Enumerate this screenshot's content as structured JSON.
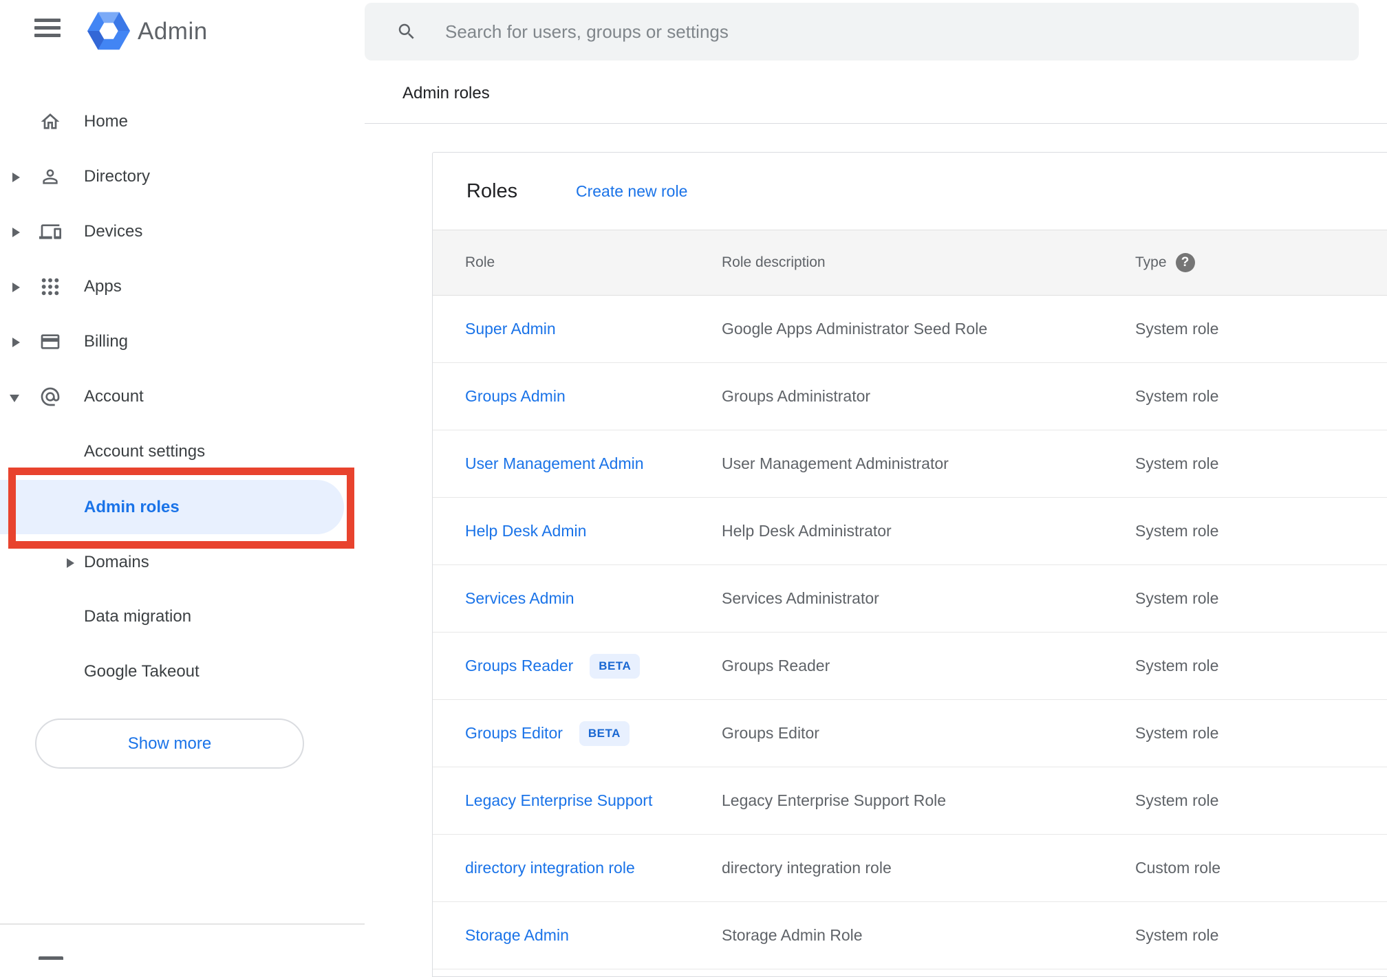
{
  "app": {
    "title": "Admin"
  },
  "search": {
    "placeholder": "Search for users, groups or settings"
  },
  "breadcrumb": "Admin roles",
  "sidebar": {
    "items": [
      {
        "label": "Home",
        "icon": "home-icon",
        "expandable": false
      },
      {
        "label": "Directory",
        "icon": "person-icon",
        "expandable": true
      },
      {
        "label": "Devices",
        "icon": "devices-icon",
        "expandable": true
      },
      {
        "label": "Apps",
        "icon": "apps-grid-icon",
        "expandable": true
      },
      {
        "label": "Billing",
        "icon": "credit-card-icon",
        "expandable": true
      },
      {
        "label": "Account",
        "icon": "at-sign-icon",
        "expandable": true,
        "expanded": true
      }
    ],
    "account_children": [
      {
        "label": "Account settings",
        "selected": false
      },
      {
        "label": "Admin roles",
        "selected": true
      },
      {
        "label": "Domains",
        "expandable": true
      },
      {
        "label": "Data migration"
      },
      {
        "label": "Google Takeout"
      }
    ],
    "show_more_label": "Show more"
  },
  "annotation": {
    "type": "red-highlight-box",
    "target": "Admin roles",
    "color": "#e8432e"
  },
  "roles_card": {
    "title": "Roles",
    "create_link": "Create new role",
    "columns": {
      "role": "Role",
      "description": "Role description",
      "type": "Type"
    },
    "beta_badge_label": "BETA",
    "rows": [
      {
        "role": "Super Admin",
        "beta": false,
        "description": "Google Apps Administrator Seed Role",
        "type": "System role"
      },
      {
        "role": "Groups Admin",
        "beta": false,
        "description": "Groups Administrator",
        "type": "System role"
      },
      {
        "role": "User Management Admin",
        "beta": false,
        "description": "User Management Administrator",
        "type": "System role"
      },
      {
        "role": "Help Desk Admin",
        "beta": false,
        "description": "Help Desk Administrator",
        "type": "System role"
      },
      {
        "role": "Services Admin",
        "beta": false,
        "description": "Services Administrator",
        "type": "System role"
      },
      {
        "role": "Groups Reader",
        "beta": true,
        "description": "Groups Reader",
        "type": "System role"
      },
      {
        "role": "Groups Editor",
        "beta": true,
        "description": "Groups Editor",
        "type": "System role"
      },
      {
        "role": "Legacy Enterprise Support",
        "beta": false,
        "description": "Legacy Enterprise Support Role",
        "type": "System role"
      },
      {
        "role": "directory integration role",
        "beta": false,
        "description": "directory integration role",
        "type": "Custom role"
      },
      {
        "role": "Storage Admin",
        "beta": false,
        "description": "Storage Admin Role",
        "type": "System role"
      }
    ]
  },
  "colors": {
    "link_blue": "#1a73e8",
    "badge_bg": "#e8f0fe",
    "badge_text": "#1967d2",
    "annotation_red": "#e8432e",
    "table_header_bg": "#f5f5f5",
    "text_gray": "#5f6368",
    "text_dark": "#202124"
  }
}
